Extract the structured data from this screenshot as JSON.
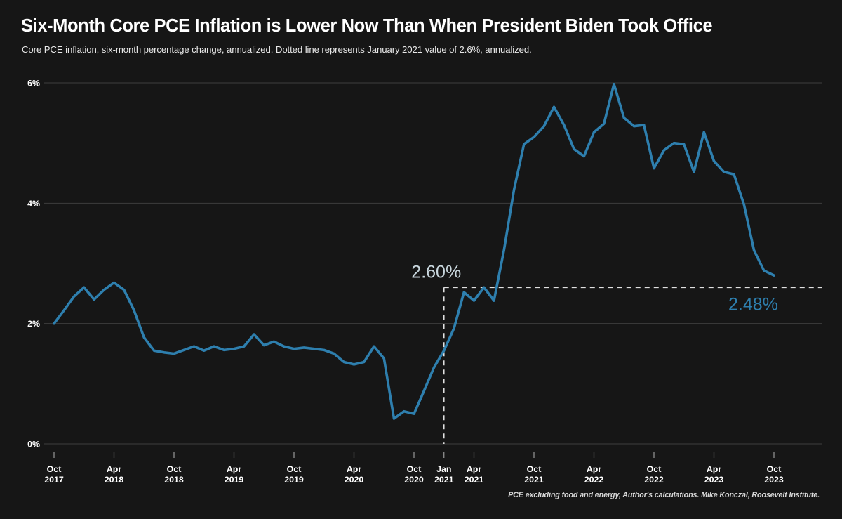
{
  "header": {
    "title": "Six-Month Core PCE Inflation is Lower Now Than When President Biden Took Office",
    "subtitle": "Core PCE inflation, six-month percentage change, annualized. Dotted line represents January 2021 value of 2.6%, annualized."
  },
  "footer": {
    "source": "PCE excluding food and energy, Author's calculations. Mike Konczal, Roosevelt Institute."
  },
  "style": {
    "background": "#161616",
    "line_color": "#2e7fae",
    "text_color": "#ffffff",
    "grid_color": "#3d3d3d",
    "annotation_start_color": "#c9d7de",
    "annotation_end_color": "#2e7fae",
    "dashed_color": "#e0e0e0"
  },
  "chart_data": {
    "type": "line",
    "title": "Six-Month Core PCE Inflation is Lower Now Than When President Biden Took Office",
    "subtitle": "Core PCE inflation, six-month percentage change, annualized. Dotted line represents January 2021 value of 2.6%, annualized.",
    "xlabel": "",
    "ylabel": "",
    "ylim": [
      0,
      6.2
    ],
    "yticks": [
      0,
      2,
      4,
      6
    ],
    "ytick_labels": [
      "0%",
      "2%",
      "4%",
      "6%"
    ],
    "grid": "horizontal",
    "legend": "none",
    "xtick_labels": [
      "Oct\n2017",
      "Apr\n2018",
      "Oct\n2018",
      "Apr\n2019",
      "Oct\n2019",
      "Apr\n2020",
      "Oct\n2020",
      "Jan\n2021",
      "Apr\n2021",
      "Oct\n2021",
      "Apr\n2022",
      "Oct\n2022",
      "Apr\n2023",
      "Oct\n2023"
    ],
    "xticks": [
      {
        "label_top": "Oct",
        "label_bottom": "2017",
        "month_index": 0
      },
      {
        "label_top": "Apr",
        "label_bottom": "2018",
        "month_index": 6
      },
      {
        "label_top": "Oct",
        "label_bottom": "2018",
        "month_index": 12
      },
      {
        "label_top": "Apr",
        "label_bottom": "2019",
        "month_index": 18
      },
      {
        "label_top": "Oct",
        "label_bottom": "2019",
        "month_index": 24
      },
      {
        "label_top": "Apr",
        "label_bottom": "2020",
        "month_index": 30
      },
      {
        "label_top": "Oct",
        "label_bottom": "2020",
        "month_index": 36
      },
      {
        "label_top": "Jan",
        "label_bottom": "2021",
        "month_index": 39
      },
      {
        "label_top": "Apr",
        "label_bottom": "2021",
        "month_index": 42
      },
      {
        "label_top": "Oct",
        "label_bottom": "2021",
        "month_index": 48
      },
      {
        "label_top": "Apr",
        "label_bottom": "2022",
        "month_index": 54
      },
      {
        "label_top": "Oct",
        "label_bottom": "2022",
        "month_index": 60
      },
      {
        "label_top": "Apr",
        "label_bottom": "2023",
        "month_index": 66
      },
      {
        "label_top": "Oct",
        "label_bottom": "2023",
        "month_index": 72
      }
    ],
    "series": [
      {
        "name": "Core PCE inflation, six-month annualized",
        "color": "#2e7fae",
        "x_start_month": "2017-10",
        "x": [
          0,
          1,
          2,
          3,
          4,
          5,
          6,
          7,
          8,
          9,
          10,
          11,
          12,
          13,
          14,
          15,
          16,
          17,
          18,
          19,
          20,
          21,
          22,
          23,
          24,
          25,
          26,
          27,
          28,
          29,
          30,
          31,
          32,
          33,
          34,
          35,
          36,
          37,
          38,
          39,
          40,
          41,
          42,
          43,
          44,
          45,
          46,
          47,
          48,
          49,
          50,
          51,
          52,
          53,
          54,
          55,
          56,
          57,
          58,
          59,
          60,
          61,
          62,
          63,
          64,
          65,
          66,
          67,
          68,
          69,
          70,
          71,
          72
        ],
        "values": [
          2.0,
          2.22,
          2.45,
          2.6,
          2.4,
          2.56,
          2.68,
          2.56,
          2.22,
          1.77,
          1.55,
          1.52,
          1.5,
          1.56,
          1.62,
          1.55,
          1.62,
          1.56,
          1.58,
          1.62,
          1.82,
          1.64,
          1.7,
          1.62,
          1.58,
          1.6,
          1.58,
          1.56,
          1.5,
          1.36,
          1.32,
          1.36,
          1.62,
          1.42,
          0.42,
          0.54,
          0.5,
          0.88,
          1.27,
          1.55,
          1.92,
          2.52,
          2.38,
          2.6,
          2.38,
          3.22,
          4.22,
          4.98,
          5.1,
          5.28,
          5.6,
          5.3,
          4.9,
          4.78,
          5.18,
          5.32,
          5.98,
          5.42,
          5.28,
          5.3,
          4.58,
          4.88,
          5.0,
          4.98,
          4.52,
          5.18,
          4.7,
          4.52,
          4.48,
          3.98,
          3.22,
          2.88,
          2.8,
          2.48
        ]
      }
    ],
    "annotations": [
      {
        "name": "jan-2021-value",
        "text": "2.60%",
        "value": 2.6,
        "month_index": 39,
        "color": "#c9d7de"
      },
      {
        "name": "latest-value",
        "text": "2.48%",
        "value": 2.48,
        "month_index": 72,
        "color": "#2e7fae"
      }
    ],
    "reference_lines": [
      {
        "name": "jan-2021-horizontal",
        "orientation": "horizontal",
        "value": 2.6,
        "style": "dashed",
        "color": "#e0e0e0"
      },
      {
        "name": "jan-2021-vertical",
        "orientation": "vertical",
        "month_index": 39,
        "style": "dashed",
        "color": "#e0e0e0"
      }
    ]
  }
}
